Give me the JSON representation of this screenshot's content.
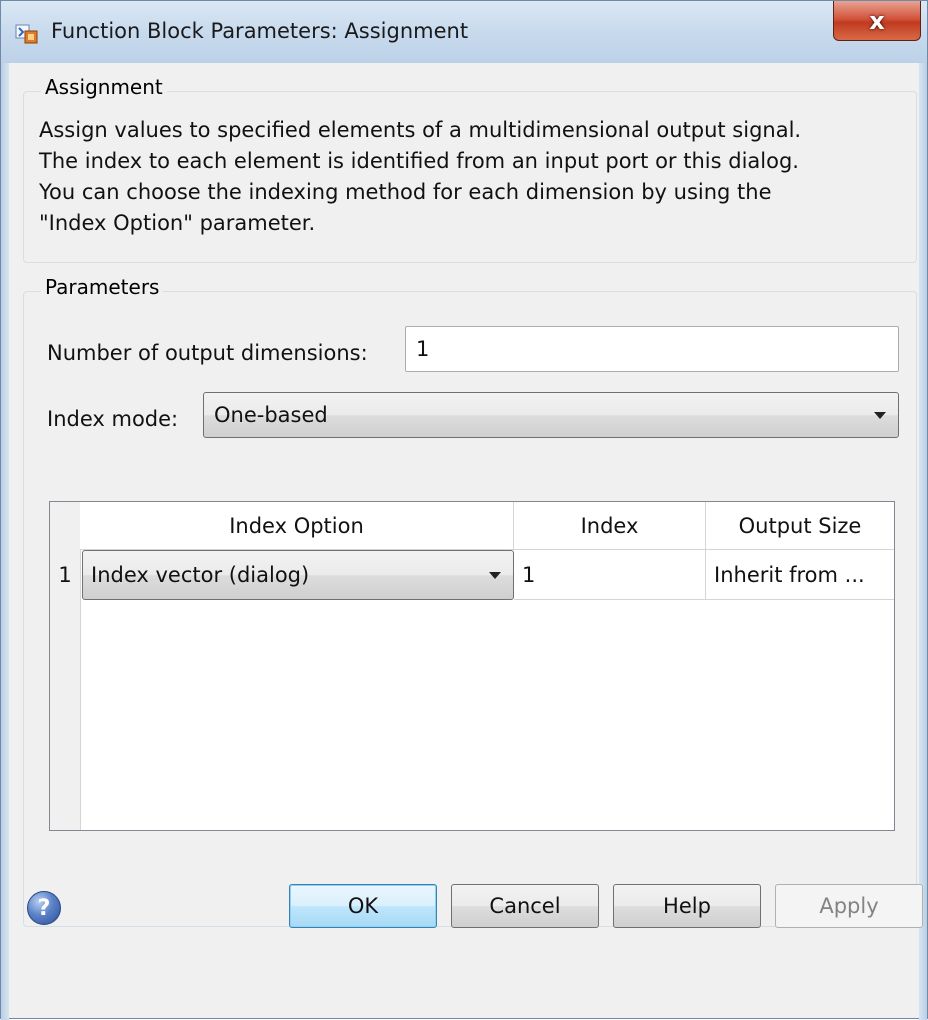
{
  "window": {
    "title": "Function Block Parameters: Assignment",
    "close_glyph": "x"
  },
  "assignment_group": {
    "legend": "Assignment",
    "description_lines": [
      "Assign values to specified elements of a multidimensional output signal.",
      "The index to each element is identified from an input port or this dialog.",
      "You can choose the indexing method for each dimension by using the",
      "\"Index Option\" parameter."
    ]
  },
  "parameters_group": {
    "legend": "Parameters",
    "num_output_dims_label": "Number of output dimensions:",
    "num_output_dims_value": "1",
    "index_mode_label": "Index mode:",
    "index_mode_value": "One-based"
  },
  "table": {
    "columns": [
      "Index Option",
      "Index",
      "Output Size"
    ],
    "rows": [
      {
        "num": "1",
        "index_option": "Index vector (dialog)",
        "index": "1",
        "output_size": "Inherit from ..."
      }
    ]
  },
  "buttons": {
    "ok": "OK",
    "cancel": "Cancel",
    "help": "Help",
    "apply": "Apply"
  },
  "colors": {
    "window_bg": "#f0f0f0",
    "title_bar": "#c8daed",
    "close_button": "#c13a20",
    "default_button_border": "#3c7fb1"
  },
  "icons": {
    "app": "simulink-block-icon",
    "close": "close-icon",
    "help": "help-question-icon",
    "dropdown": "chevron-down-icon"
  }
}
